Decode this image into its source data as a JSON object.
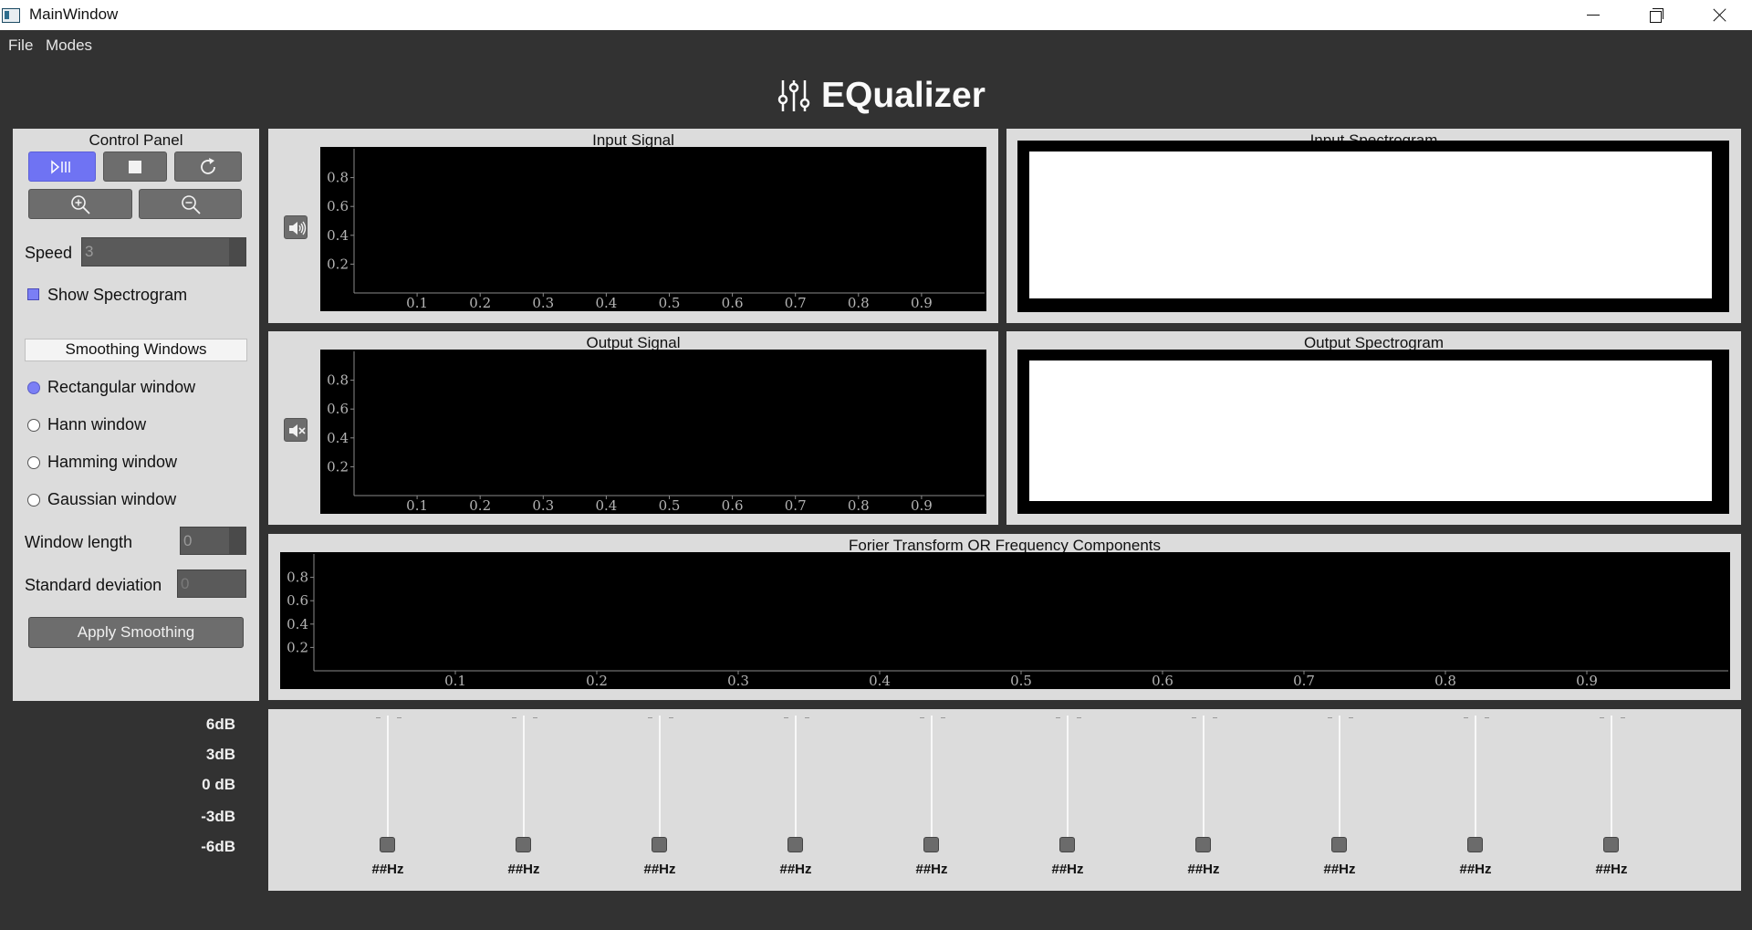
{
  "window": {
    "title": "MainWindow"
  },
  "menu": [
    "File",
    "Modes"
  ],
  "header": {
    "title": "EQualizer"
  },
  "control_panel": {
    "title": "Control Panel",
    "speed_label": "Speed",
    "speed_value": "3",
    "show_spectrogram_label": "Show Spectrogram",
    "smoothing_header": "Smoothing Windows",
    "windows": [
      "Rectangular window",
      "Hann window",
      "Hamming window",
      "Gaussian window"
    ],
    "selected_window": "Rectangular window",
    "window_length_label": "Window length",
    "window_length_value": "0",
    "std_label": "Standard deviation",
    "std_value": "0",
    "apply_label": "Apply Smoothing"
  },
  "input_panel": {
    "title": "Input Signal"
  },
  "output_panel": {
    "title": "Output Signal"
  },
  "input_spec_panel": {
    "title": "Input Spectrogram"
  },
  "output_spec_panel": {
    "title": "Output Spectrogram"
  },
  "fourier_panel": {
    "title": "Forier Transform OR Frequency Components"
  },
  "equalizer": {
    "db_labels": [
      "6dB",
      "3dB",
      "0 dB",
      "-3dB",
      "-6dB"
    ],
    "bands": [
      "##Hz",
      "##Hz",
      "##Hz",
      "##Hz",
      "##Hz",
      "##Hz",
      "##Hz",
      "##Hz",
      "##Hz",
      "##Hz"
    ]
  },
  "chart_data": [
    {
      "type": "line",
      "title": "Input Signal",
      "x_ticks": [
        "0.1",
        "0.2",
        "0.3",
        "0.4",
        "0.5",
        "0.6",
        "0.7",
        "0.8",
        "0.9"
      ],
      "y_ticks": [
        "0.2",
        "0.4",
        "0.6",
        "0.8"
      ],
      "xlim": [
        0,
        1
      ],
      "ylim": [
        0,
        1
      ],
      "series": []
    },
    {
      "type": "line",
      "title": "Output Signal",
      "x_ticks": [
        "0.1",
        "0.2",
        "0.3",
        "0.4",
        "0.5",
        "0.6",
        "0.7",
        "0.8",
        "0.9"
      ],
      "y_ticks": [
        "0.2",
        "0.4",
        "0.6",
        "0.8"
      ],
      "xlim": [
        0,
        1
      ],
      "ylim": [
        0,
        1
      ],
      "series": []
    },
    {
      "type": "line",
      "title": "Forier Transform OR Frequency Components",
      "x_ticks": [
        "0.1",
        "0.2",
        "0.3",
        "0.4",
        "0.5",
        "0.6",
        "0.7",
        "0.8",
        "0.9"
      ],
      "y_ticks": [
        "0.2",
        "0.4",
        "0.6",
        "0.8"
      ],
      "xlim": [
        0,
        1
      ],
      "ylim": [
        0,
        1
      ],
      "series": []
    }
  ]
}
